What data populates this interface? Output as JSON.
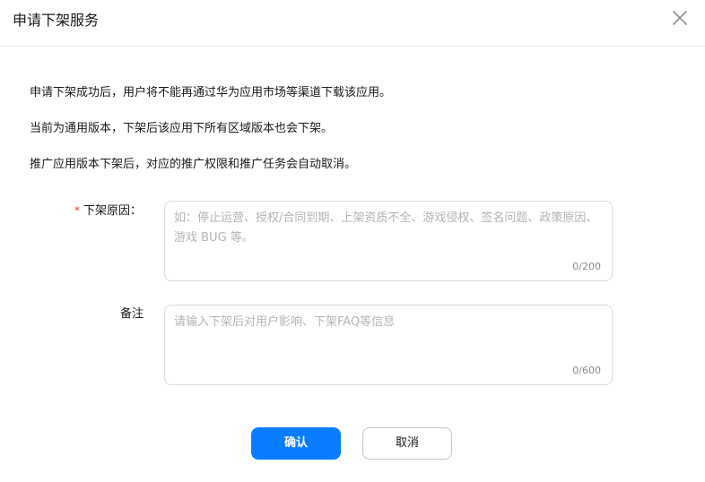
{
  "dialog": {
    "title": "申请下架服务",
    "close_icon": "close-icon"
  },
  "notices": [
    "申请下架成功后，用户将不能再通过华为应用市场等渠道下载该应用。",
    "当前为通用版本，下架后该应用下所有区域版本也会下架。",
    "推广应用版本下架后，对应的推广权限和推广任务会自动取消。"
  ],
  "form": {
    "reason": {
      "required_mark": "*",
      "label": "下架原因：",
      "value": "",
      "placeholder": "如：停止运营、授权/合同到期、上架资质不全、游戏侵权、签名问题、政策原因、游戏 BUG 等。",
      "counter": "0/200"
    },
    "remark": {
      "label": "备注",
      "value": "",
      "placeholder": "请输入下架后对用户影响、下架FAQ等信息",
      "counter": "0/600"
    }
  },
  "buttons": {
    "confirm": "确认",
    "cancel": "取消"
  },
  "colors": {
    "primary": "#0a7dff",
    "required": "#e84026",
    "placeholder": "#b4b4b4",
    "border": "#dcdcdc"
  }
}
